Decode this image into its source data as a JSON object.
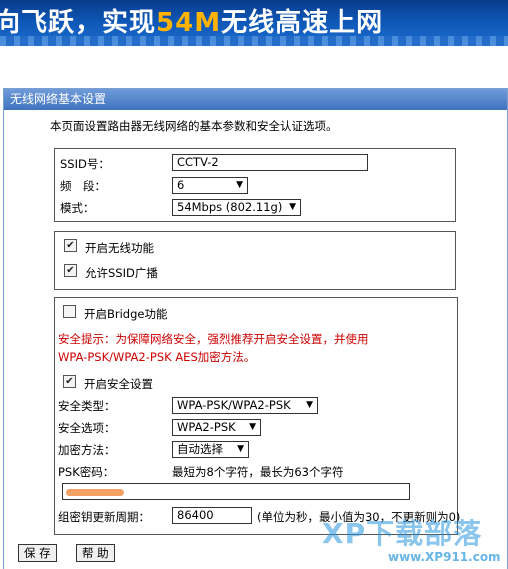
{
  "banner": {
    "slogan_pre": "向飞跃，实现",
    "slogan_hl": "54M",
    "slogan_post": "无线高速上网"
  },
  "panel": {
    "title": "无线网络基本设置",
    "intro": "本页面设置路由器无线网络的基本参数和安全认证选项。"
  },
  "basic": {
    "ssid_label": "SSID号：",
    "ssid_value": "CCTV-2",
    "channel_label": "频　段：",
    "channel_value": "6",
    "mode_label": "模式：",
    "mode_value": "54Mbps (802.11g)"
  },
  "toggles": {
    "enable_wireless": {
      "label": "开启无线功能",
      "checked": true
    },
    "allow_ssid_broadcast": {
      "label": "允许SSID广播",
      "checked": true
    }
  },
  "security": {
    "bridge": {
      "label": "开启Bridge功能",
      "checked": false
    },
    "warning_line1": "安全提示：为保障网络安全，强烈推荐开启安全设置，并使用",
    "warning_line2": "WPA-PSK/WPA2-PSK AES加密方法。",
    "enable_security": {
      "label": "开启安全设置",
      "checked": true
    },
    "type_label": "安全类型：",
    "type_value": "WPA-PSK/WPA2-PSK",
    "option_label": "安全选项：",
    "option_value": "WPA2-PSK",
    "encryption_label": "加密方法：",
    "encryption_value": "自动选择",
    "psk_label": "PSK密码：",
    "psk_hint": "最短为8个字符，最长为63个字符",
    "rekey_label": "组密钥更新周期：",
    "rekey_value": "86400",
    "rekey_note": "(单位为秒，最小值为30，不更新则为0)"
  },
  "buttons": {
    "save": "保 存",
    "help": "帮 助"
  },
  "watermark": {
    "brand": "XP下载部落",
    "url": "www.XP911.com"
  },
  "colors": {
    "title_bar": "#4a7fc8",
    "warning": "#cc0000",
    "banner": "#0d56b5"
  }
}
